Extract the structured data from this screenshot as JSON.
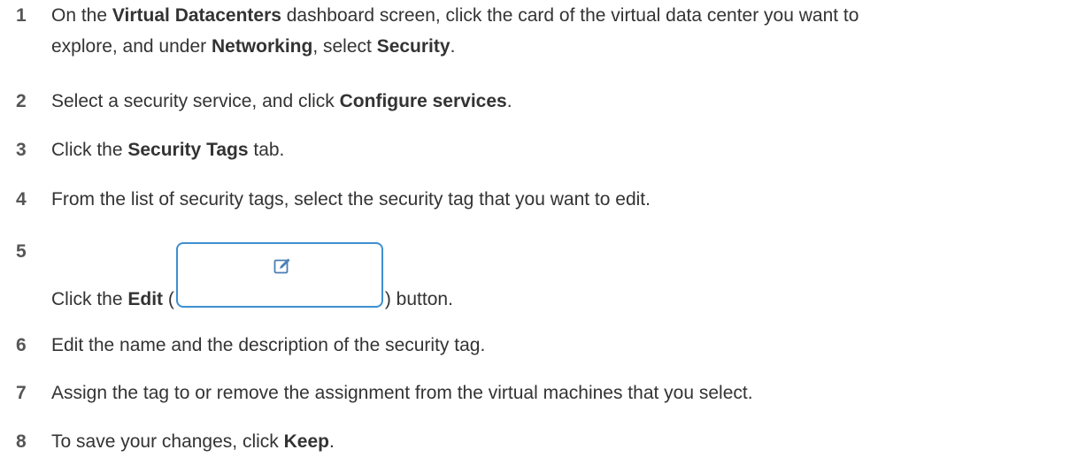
{
  "steps": [
    {
      "num": "1",
      "t1": "On the ",
      "b1": "Virtual Datacenters",
      "t2": " dashboard screen, click the card of the virtual data center you want to",
      "t3": "explore, and under ",
      "b2": "Networking",
      "t4": ", select ",
      "b3": "Security",
      "t5": "."
    },
    {
      "num": "2",
      "t1": "Select a security service, and click ",
      "b1": "Configure services",
      "t2": "."
    },
    {
      "num": "3",
      "t1": "Click the ",
      "b1": "Security Tags",
      "t2": " tab."
    },
    {
      "num": "4",
      "t1": "From the list of security tags, select the security tag that you want to edit."
    },
    {
      "num": "5",
      "t1": "Click the ",
      "b1": "Edit",
      "t2": " (",
      "t3": ") button.",
      "icon": "edit-icon"
    },
    {
      "num": "6",
      "t1": "Edit the name and the description of the security tag."
    },
    {
      "num": "7",
      "t1": "Assign the tag to or remove the assignment from the virtual machines that you select."
    },
    {
      "num": "8",
      "t1": "To save your changes, click ",
      "b1": "Keep",
      "t2": "."
    }
  ],
  "colors": {
    "text": "#333333",
    "number": "#565656",
    "button_border": "#3d8fd1",
    "icon": "#4a7db5"
  }
}
